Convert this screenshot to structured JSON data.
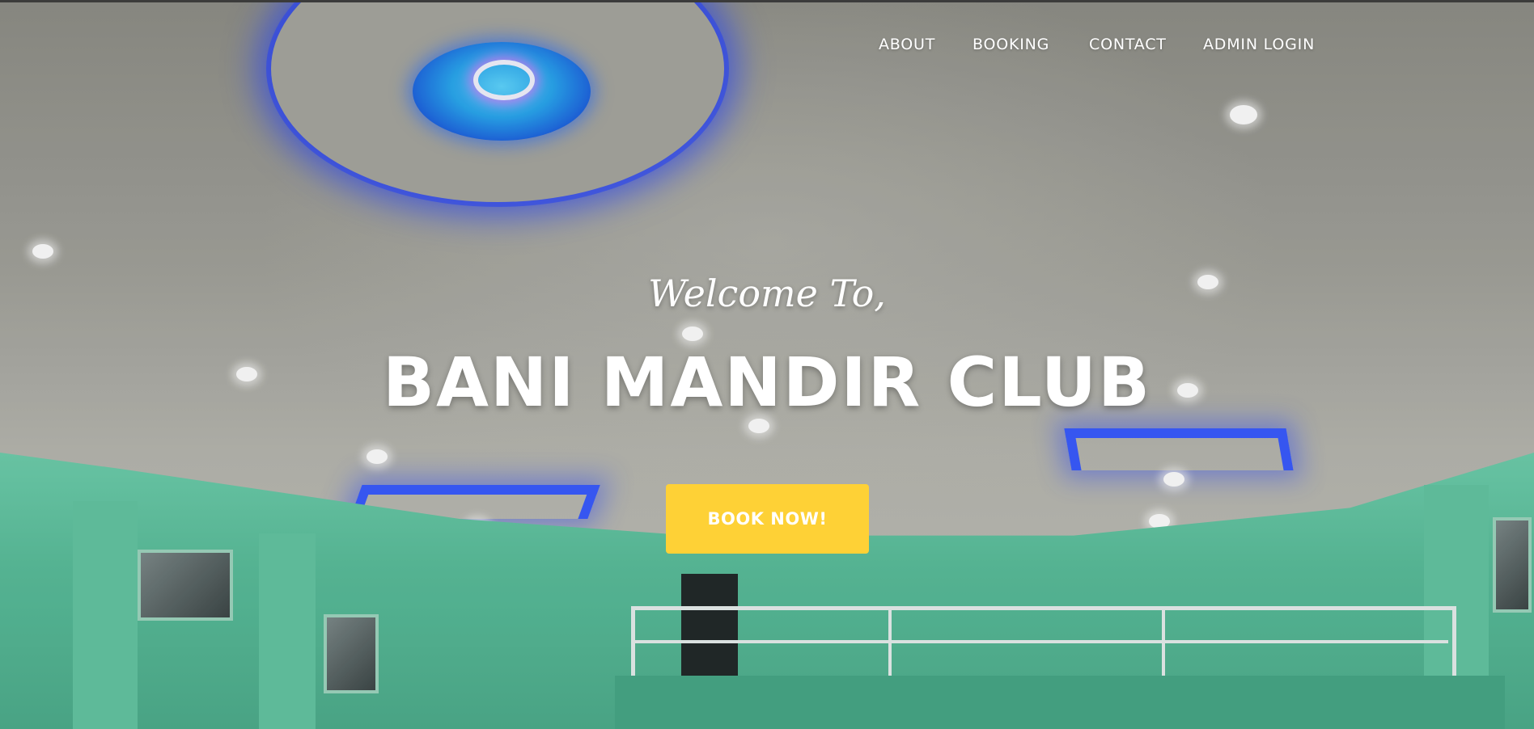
{
  "nav": {
    "items": [
      {
        "label": "ABOUT"
      },
      {
        "label": "BOOKING"
      },
      {
        "label": "CONTACT"
      },
      {
        "label": "ADMIN LOGIN"
      }
    ]
  },
  "hero": {
    "subheading": "Welcome To,",
    "heading": "BANI MANDIR CLUB",
    "cta_label": "BOOK NOW!"
  },
  "colors": {
    "accent": "#fed136",
    "text": "#ffffff",
    "wall": "#5bbf9c",
    "ceiling_light": "#3a5cff"
  }
}
